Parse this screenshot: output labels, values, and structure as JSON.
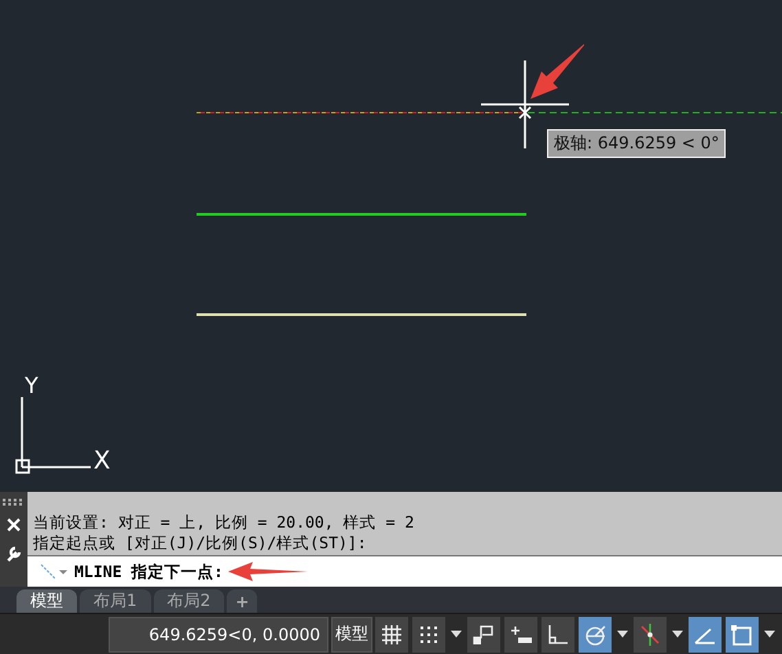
{
  "canvas": {
    "tooltip": "极轴: 649.6259 < 0°",
    "ucs": {
      "x_label": "X",
      "y_label": "Y"
    }
  },
  "command_line": {
    "history": [
      "当前设置: 对正 = 上, 比例 = 20.00, 样式 = 2",
      "指定起点或 [对正(J)/比例(S)/样式(ST)]:"
    ],
    "prompt": "MLINE 指定下一点:"
  },
  "tabs": [
    {
      "label": "模型",
      "selected": true
    },
    {
      "label": "布局1",
      "selected": false
    },
    {
      "label": "布局2",
      "selected": false
    }
  ],
  "add_tab": "+",
  "status_bar": {
    "coordinates": "649.6259<0, 0.0000",
    "space": "模型",
    "toggles": [
      {
        "kind": "grid",
        "on": false,
        "menu": false
      },
      {
        "kind": "snap",
        "on": false,
        "menu": true
      },
      {
        "kind": "infer",
        "on": false,
        "menu": false
      },
      {
        "kind": "dynamic-input",
        "on": false,
        "menu": false
      },
      {
        "kind": "ortho",
        "on": false,
        "menu": false
      },
      {
        "kind": "polar",
        "on": true,
        "menu": true
      },
      {
        "kind": "tracking",
        "on": false,
        "menu": true
      },
      {
        "kind": "ucs",
        "on": true,
        "menu": false
      },
      {
        "kind": "selection",
        "on": true,
        "menu": true
      }
    ]
  }
}
